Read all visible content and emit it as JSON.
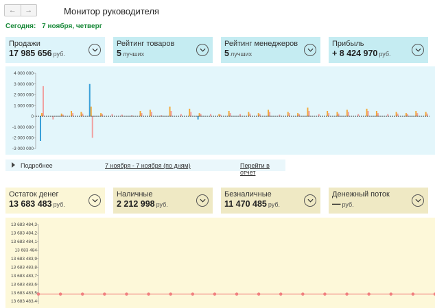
{
  "header": {
    "title": "Монитор руководителя",
    "nav_back_icon": "arrow-left-icon",
    "nav_forward_icon": "arrow-right-icon"
  },
  "today": {
    "label": "Сегодня:",
    "value": "7 ноября, четверг",
    "color": "#1a8a3a"
  },
  "sales_cards": [
    {
      "label": "Продажи",
      "value": "17 985 656",
      "unit": "руб."
    },
    {
      "label": "Рейтинг товаров",
      "value": "5",
      "unit": "лучших"
    },
    {
      "label": "Рейтинг менеджеров",
      "value": "5",
      "unit": "лучших"
    },
    {
      "label": "Прибыль",
      "value": "+ 8 424 970",
      "unit": "руб."
    }
  ],
  "money_cards": [
    {
      "label": "Остаток денег",
      "value": "13 683 483",
      "unit": "руб."
    },
    {
      "label": "Наличные",
      "value": "2 212 998",
      "unit": "руб."
    },
    {
      "label": "Безналичные",
      "value": "11 470 485",
      "unit": "руб."
    },
    {
      "label": "Денежный поток",
      "value": "—",
      "unit": "руб."
    }
  ],
  "footer": {
    "more_label": "Подробнее",
    "period_link": "7 ноября - 7 ноября (по дням)",
    "report_link": "Перейти в отчет"
  },
  "colors": {
    "sales_panel": "#e3f6fb",
    "money_panel": "#fdf8d9",
    "bar_blue": "#3aa0d8",
    "bar_orange": "#f2a93b",
    "bar_pink": "#f0a0a0",
    "line_red": "#f08080"
  },
  "chart_data": [
    {
      "type": "bar",
      "title": "",
      "ylim": [
        -3000000,
        4000000
      ],
      "y_ticks": [
        "4 000 000",
        "3 000 000",
        "2 000 000",
        "1 000 000",
        "0",
        "-1 000 000",
        "-2 000 000",
        "-3 000 000"
      ],
      "y_tick_values": [
        4000000,
        3000000,
        2000000,
        1000000,
        0,
        -1000000,
        -2000000,
        -3000000
      ],
      "series": [
        {
          "color": "#3aa0d8",
          "values": [
            -2300000,
            0,
            0,
            0,
            0,
            3000000,
            0,
            0,
            0,
            0,
            0,
            0,
            0,
            0,
            0,
            0,
            -300000,
            0,
            0,
            0,
            0,
            0,
            0,
            0,
            0,
            0,
            0,
            0,
            0,
            0,
            0,
            0,
            0,
            0,
            0,
            0,
            0,
            0,
            0,
            0
          ]
        },
        {
          "color": "#f2a93b",
          "values": [
            300000,
            0,
            250000,
            500000,
            400000,
            900000,
            300000,
            0,
            0,
            0,
            500000,
            600000,
            0,
            900000,
            0,
            700000,
            300000,
            0,
            200000,
            500000,
            0,
            400000,
            300000,
            600000,
            0,
            400000,
            300000,
            800000,
            0,
            500000,
            400000,
            600000,
            0,
            700000,
            500000,
            0,
            400000,
            300000,
            500000,
            400000
          ]
        },
        {
          "color": "#f0a0a0",
          "values": [
            2800000,
            -300000,
            150000,
            300000,
            250000,
            -2000000,
            200000,
            200000,
            150000,
            100000,
            300000,
            400000,
            100000,
            500000,
            200000,
            400000,
            200000,
            200000,
            150000,
            300000,
            200000,
            250000,
            200000,
            400000,
            150000,
            300000,
            200000,
            500000,
            200000,
            300000,
            250000,
            400000,
            200000,
            500000,
            300000,
            200000,
            250000,
            200000,
            300000,
            250000
          ]
        }
      ]
    },
    {
      "type": "line",
      "title": "",
      "ylim": [
        13683483.4,
        13683484.3
      ],
      "y_ticks": [
        "13 683 484,3",
        "13 683 484,2",
        "13 683 484,1",
        "13 683 484",
        "13 683 483,9",
        "13 683 483,8",
        "13 683 483,7",
        "13 683 483,6",
        "13 683 483,5",
        "13 683 483,4"
      ],
      "y_tick_values": [
        13683484.3,
        13683484.2,
        13683484.1,
        13683484.0,
        13683483.9,
        13683483.8,
        13683483.7,
        13683483.6,
        13683483.5,
        13683483.4
      ],
      "series": [
        {
          "color": "#f08080",
          "values": [
            13683483.483,
            13683483.483,
            13683483.483,
            13683483.483,
            13683483.483,
            13683483.483,
            13683483.483,
            13683483.483,
            13683483.483,
            13683483.483,
            13683483.483,
            13683483.483,
            13683483.483,
            13683483.483,
            13683483.483,
            13683483.483,
            13683483.483,
            13683483.483,
            13683483.483
          ]
        }
      ]
    }
  ]
}
